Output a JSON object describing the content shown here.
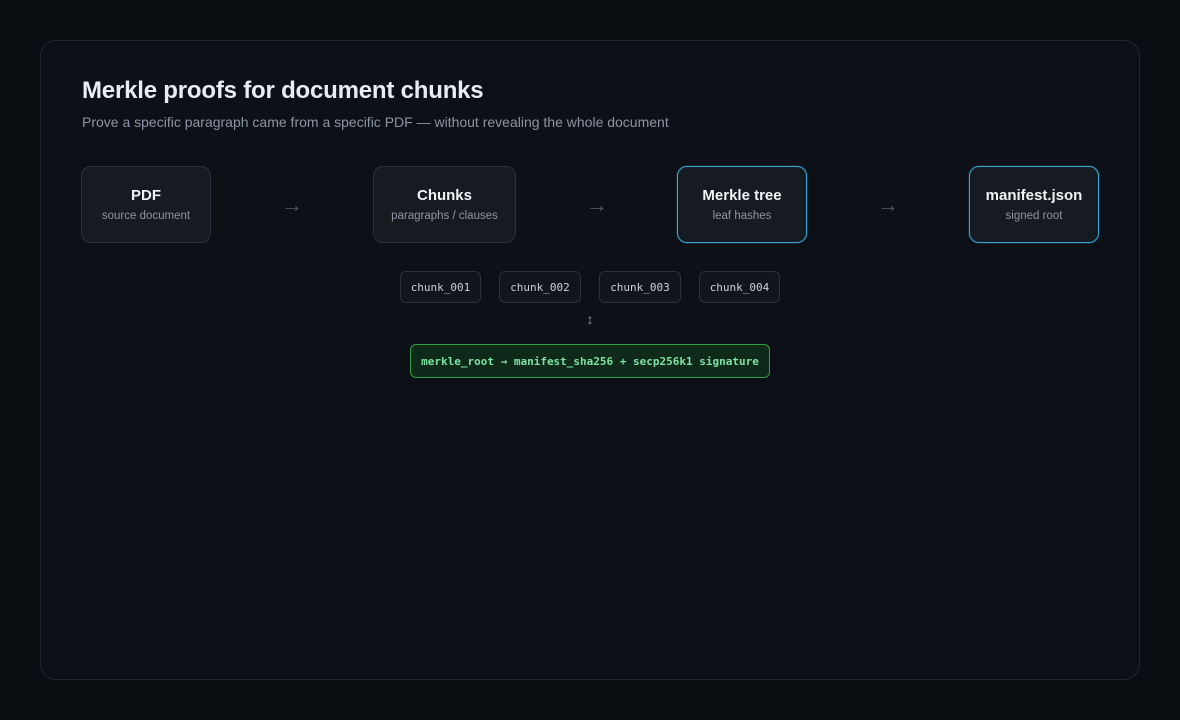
{
  "title": "Merkle proofs for document chunks",
  "subtitle": "Prove a specific paragraph came from a specific PDF — without revealing the whole document",
  "pipeline": {
    "nodes": [
      {
        "label": "PDF",
        "sub": "source document",
        "highlighted": false
      },
      {
        "label": "Chunks",
        "sub": "paragraphs / clauses",
        "highlighted": false
      },
      {
        "label": "Merkle tree",
        "sub": "leaf hashes",
        "highlighted": true
      },
      {
        "label": "manifest.json",
        "sub": "signed root",
        "highlighted": true
      }
    ],
    "arrow_glyph": "→"
  },
  "chunks": [
    "chunk_001",
    "chunk_002",
    "chunk_003",
    "chunk_004"
  ],
  "updown_glyph": "↕",
  "root_line": "merkle_root → manifest_sha256 + secp256k1 signature",
  "colors": {
    "background": "#0a0d12",
    "card": "#0d1117",
    "highlight_border": "#3aa6d6",
    "root_border": "#2ea043",
    "root_text": "#7ee2a0"
  }
}
